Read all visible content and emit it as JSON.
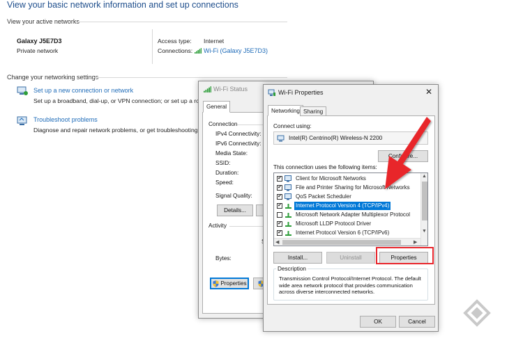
{
  "control_panel": {
    "title": "View your basic network information and set up connections",
    "active_networks_heading": "View your active networks",
    "network_name": "Galaxy J5E7D3",
    "network_type": "Private network",
    "access_type_label": "Access type:",
    "access_type_value": "Internet",
    "connections_label": "Connections:",
    "connections_value": "Wi-Fi (Galaxy J5E7D3)",
    "change_settings_heading": "Change your networking settings",
    "setup_link": "Set up a new connection or network",
    "setup_desc": "Set up a broadband, dial-up, or VPN connection; or set up a route",
    "troubleshoot_link": "Troubleshoot problems",
    "troubleshoot_desc": "Diagnose and repair network problems, or get troubleshooting in"
  },
  "wifi_status": {
    "title": "Wi-Fi Status",
    "tab_general": "General",
    "connection_heading": "Connection",
    "ipv4": "IPv4 Connectivity:",
    "ipv6": "IPv6 Connectivity:",
    "media_state": "Media State:",
    "ssid": "SSID:",
    "duration": "Duration:",
    "speed": "Speed:",
    "signal_quality": "Signal Quality:",
    "details_button": "Details...",
    "activity_heading": "Activity",
    "sent_fragment": "S",
    "bytes": "Bytes:",
    "properties_button": "Properties"
  },
  "wifi_properties": {
    "title": "Wi-Fi Properties",
    "tab_networking": "Networking",
    "tab_sharing": "Sharing",
    "connect_using_label": "Connect using:",
    "adapter": "Intel(R) Centrino(R) Wireless-N 2200",
    "configure_button": "Configure...",
    "items_label": "This connection uses the following items:",
    "items": [
      {
        "label": "Client for Microsoft Networks",
        "checked": true,
        "selected": false
      },
      {
        "label": "File and Printer Sharing for Microsoft Networks",
        "checked": true,
        "selected": false
      },
      {
        "label": "QoS Packet Scheduler",
        "checked": true,
        "selected": false
      },
      {
        "label": "Internet Protocol Version 4 (TCP/IPv4)",
        "checked": true,
        "selected": true
      },
      {
        "label": "Microsoft Network Adapter Multiplexor Protocol",
        "checked": false,
        "selected": false
      },
      {
        "label": "Microsoft LLDP Protocol Driver",
        "checked": true,
        "selected": false
      },
      {
        "label": "Internet Protocol Version 6 (TCP/IPv6)",
        "checked": true,
        "selected": false
      }
    ],
    "install_button": "Install...",
    "uninstall_button": "Uninstall",
    "properties_button": "Properties",
    "description_label": "Description",
    "description_text": "Transmission Control Protocol/Internet Protocol. The default wide area network protocol that provides communication across diverse interconnected networks.",
    "ok_button": "OK",
    "cancel_button": "Cancel",
    "close_icon": "close-icon"
  },
  "colors": {
    "accent": "#0078d7",
    "link": "#1e6bb8",
    "highlight": "#e8262c"
  }
}
